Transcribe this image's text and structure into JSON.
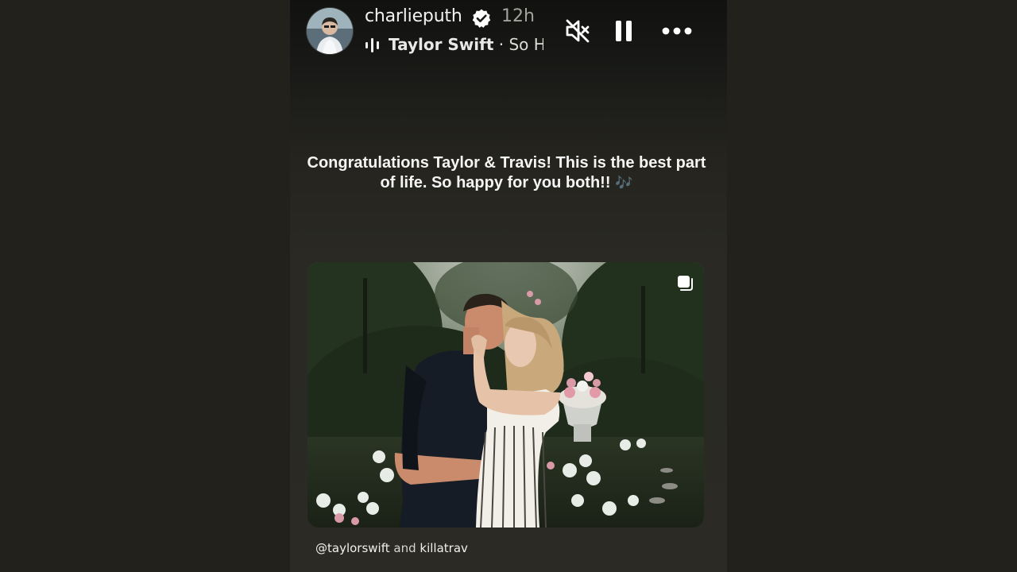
{
  "story": {
    "user": {
      "username": "charlieputh",
      "time_ago": "12h",
      "avatar_icon": "profile-avatar"
    },
    "music": {
      "artist": "Taylor Swift",
      "separator": " · ",
      "song": "So High School"
    },
    "controls": {
      "mute_icon": "muted-speaker-icon",
      "pause_icon": "pause-icon",
      "more_icon": "more-options-icon"
    },
    "caption": {
      "text": "Congratulations Taylor & Travis! This is the best part of life. So happy for you both!!",
      "emoji": "🎶"
    },
    "shared_post": {
      "multi_image": true,
      "tag_first": "@taylorswift",
      "tag_joiner": " and ",
      "tag_second": "killatrav"
    }
  },
  "colors": {
    "background": "#22211c",
    "story_panel": "#2b2a24",
    "text_primary": "#f2f2f2",
    "text_secondary": "#a3a39d",
    "verified_badge": "#ffffff"
  }
}
